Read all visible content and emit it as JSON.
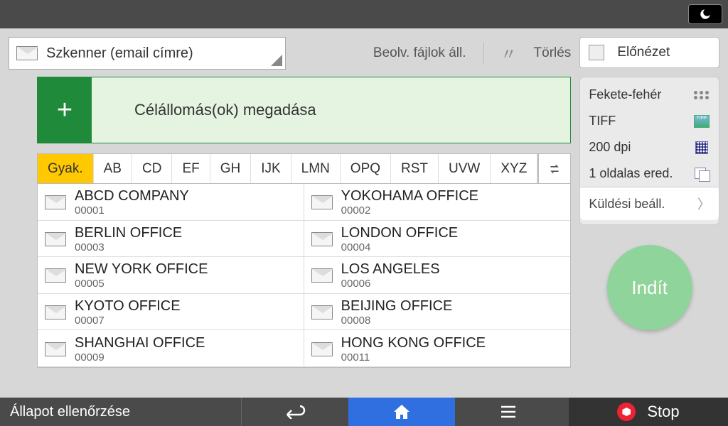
{
  "mode_label": "Szkenner (email címre)",
  "top_actions": {
    "scan_files": "Beolv. fájlok áll.",
    "clear": "Törlés"
  },
  "destination": {
    "add_symbol": "+",
    "label": "Célállomás(ok) megadása"
  },
  "tabs": [
    "Gyak.",
    "AB",
    "CD",
    "EF",
    "GH",
    "IJK",
    "LMN",
    "OPQ",
    "RST",
    "UVW",
    "XYZ"
  ],
  "active_tab": 0,
  "addresses": [
    {
      "name": "ABCD COMPANY",
      "num": "00001"
    },
    {
      "name": "YOKOHAMA OFFICE",
      "num": "00002"
    },
    {
      "name": "BERLIN OFFICE",
      "num": "00003"
    },
    {
      "name": "LONDON OFFICE",
      "num": "00004"
    },
    {
      "name": "NEW YORK OFFICE",
      "num": "00005"
    },
    {
      "name": "LOS ANGELES",
      "num": "00006"
    },
    {
      "name": "KYOTO OFFICE",
      "num": "00007"
    },
    {
      "name": "BEIJING OFFICE",
      "num": "00008"
    },
    {
      "name": "SHANGHAI  OFFICE",
      "num": "00009"
    },
    {
      "name": "HONG KONG OFFICE",
      "num": "00011"
    }
  ],
  "preview_label": "Előnézet",
  "settings": {
    "color": "Fekete-fehér",
    "format": "TIFF",
    "resolution": "200 dpi",
    "sides": "1 oldalas ered.",
    "send_settings": "Küldési beáll."
  },
  "start_label": "Indít",
  "bottom": {
    "status": "Állapot ellenőrzése",
    "stop": "Stop"
  }
}
